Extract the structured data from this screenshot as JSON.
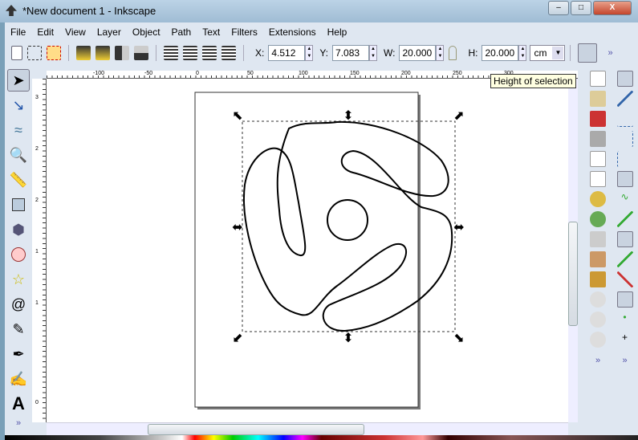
{
  "window": {
    "title": "*New document 1 - Inkscape",
    "min": "–",
    "max": "□",
    "close": "X"
  },
  "menu": [
    "File",
    "Edit",
    "View",
    "Layer",
    "Object",
    "Path",
    "Text",
    "Filters",
    "Extensions",
    "Help"
  ],
  "toolbar": {
    "x_label": "X:",
    "x": "4.512",
    "y_label": "Y:",
    "y": "7.083",
    "w_label": "W:",
    "w": "20.000",
    "h_label": "H:",
    "h": "20.000",
    "unit": "cm",
    "more": "»"
  },
  "tooltip": "Height of selection",
  "ruler": {
    "h": [
      "-100",
      "-50",
      "0",
      "50",
      "100",
      "150",
      "200",
      "250",
      "300"
    ],
    "v": [
      "3",
      "2",
      "2",
      "1",
      "1",
      "0"
    ]
  },
  "tools": [
    "selector",
    "node",
    "tweak",
    "zoom",
    "measure",
    "rectangle",
    "3d-box",
    "ellipse",
    "star",
    "spiral",
    "pencil",
    "pen",
    "calligraphy",
    "text"
  ],
  "more": "»",
  "colors": {
    "accent": "#dfe7f1",
    "selection": "#000000"
  }
}
